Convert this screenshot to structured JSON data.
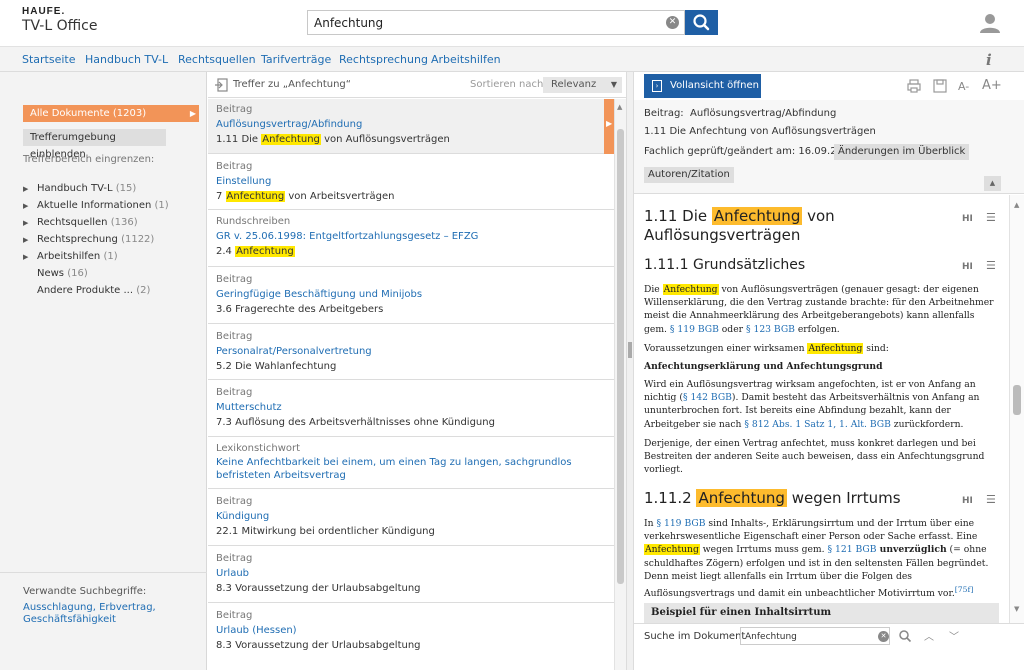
{
  "brand": {
    "logo": "HAUFE.",
    "product": "TV-L Office"
  },
  "search": {
    "value": "Anfechtung",
    "placeholder": ""
  },
  "nav": [
    "Startseite",
    "Handbuch TV-L",
    "Rechtsquellen",
    "Tarifverträge",
    "Rechtsprechung",
    "Arbeitshilfen"
  ],
  "left": {
    "all_docs": "Alle Dokumente (1203)",
    "show_env": "Trefferumgebung einblenden",
    "narrow_label": "Trefferbereich eingrenzen:",
    "facets": [
      {
        "label": "Handbuch TV-L",
        "count": "(15)",
        "expandable": true
      },
      {
        "label": "Aktuelle Informationen",
        "count": "(1)",
        "expandable": true
      },
      {
        "label": "Rechtsquellen",
        "count": "(136)",
        "expandable": true
      },
      {
        "label": "Rechtsprechung",
        "count": "(1122)",
        "expandable": true
      },
      {
        "label": "Arbeitshilfen",
        "count": "(1)",
        "expandable": true
      },
      {
        "label": "News",
        "count": "(16)",
        "expandable": false
      },
      {
        "label": "Andere Produkte ...",
        "count": "(2)",
        "expandable": false
      }
    ],
    "related_label": "Verwandte Suchbegriffe:",
    "related_links": "Ausschlagung, Erbvertrag, Geschäftsfähigkeit"
  },
  "hits_header": {
    "label": "Treffer zu „Anfechtung“",
    "sort_label": "Sortieren nach:",
    "sort_value": "Relevanz"
  },
  "hits": [
    {
      "category": "Beitrag",
      "title": "Auflösungsvertrag/Abfindung",
      "sub_pre": "1.11 Die ",
      "sub_hl": "Anfechtung",
      "sub_post": " von Auflösungsverträgen"
    },
    {
      "category": "Beitrag",
      "title": "Einstellung",
      "sub_pre": "7 ",
      "sub_hl": "Anfechtung",
      "sub_post": " von Arbeitsverträgen"
    },
    {
      "category": "Rundschreiben",
      "title": "GR v. 25.06.1998: Entgeltfortzahlungsgesetz – EFZG",
      "sub_pre": "2.4 ",
      "sub_hl": "Anfechtung",
      "sub_post": ""
    },
    {
      "category": "Beitrag",
      "title": "Geringfügige Beschäftigung und Minijobs",
      "sub_pre": "3.6 Fragerechte des Arbeitgebers",
      "sub_hl": "",
      "sub_post": ""
    },
    {
      "category": "Beitrag",
      "title": "Personalrat/Personalvertretung",
      "sub_pre": "5.2 Die Wahlanfechtung",
      "sub_hl": "",
      "sub_post": ""
    },
    {
      "category": "Beitrag",
      "title": "Mutterschutz",
      "sub_pre": "7.3 Auflösung des Arbeitsverhältnisses ohne Kündigung",
      "sub_hl": "",
      "sub_post": ""
    },
    {
      "category": "Lexikonstichwort",
      "title": "Keine Anfechtbarkeit bei einem, um einen Tag zu langen, sachgrundlos befristeten Arbeitsvertrag",
      "sub_pre": "",
      "sub_hl": "",
      "sub_post": ""
    },
    {
      "category": "Beitrag",
      "title": "Kündigung",
      "sub_pre": "22.1 Mitwirkung bei ordentlicher Kündigung",
      "sub_hl": "",
      "sub_post": ""
    },
    {
      "category": "Beitrag",
      "title": "Urlaub",
      "sub_pre": "8.3 Voraussetzung der Urlaubsabgeltung",
      "sub_hl": "",
      "sub_post": ""
    },
    {
      "category": "Beitrag",
      "title": "Urlaub (Hessen)",
      "sub_pre": "8.3 Voraussetzung der Urlaubsabgeltung",
      "sub_hl": "",
      "sub_post": ""
    }
  ],
  "right": {
    "fullview_label": "Vollansicht öffnen",
    "meta_label": "Beitrag:",
    "meta_title": "Auflösungsvertrag/Abfindung",
    "meta_section": "1.11 Die Anfechtung von Auflösungsverträgen",
    "meta_checked": "Fachlich geprüft/geändert am: 16.09.2015",
    "changes_btn": "Änderungen im Überblick",
    "authors_btn": "Autoren/Zitation",
    "h1_pre": "1.11 Die ",
    "h1_hl": "Anfechtung",
    "h1_post": " von Auflösungsverträgen",
    "h2a": "1.11.1 Grundsätzliches",
    "p1": {
      "a": "Die ",
      "hl": "Anfechtung",
      "b": " von Auflösungsverträgen (genauer gesagt: der eigenen Willenserklärung, die den Vertrag zustande brachte: für den Arbeitnehmer meist die Annahmeerklärung des Arbeitgeberangebots) kann allenfalls gem. ",
      "l1": "§ 119 BGB",
      "c": " oder ",
      "l2": "§ 123 BGB",
      "d": " erfolgen."
    },
    "p2": {
      "a": "Voraussetzungen einer wirksamen ",
      "hl": "Anfechtung",
      "b": " sind:"
    },
    "p3": "Anfechtungserklärung und Anfechtungsgrund",
    "p4": {
      "a": "Wird ein Auflösungsvertrag wirksam angefochten, ist er von Anfang an nichtig (",
      "l1": "§ 142 BGB",
      "b": "). Damit besteht das Arbeitsverhältnis von Anfang an ununterbrochen fort. Ist bereits eine Abfindung bezahlt, kann der Arbeitgeber sie nach ",
      "l2": "§ 812 Abs. 1 Satz 1, 1. Alt. BGB",
      "c": " zurückfordern."
    },
    "p5": "Derjenige, der einen Vertrag anfechtet, muss konkret darlegen und bei Bestreiten der anderen Seite auch beweisen, dass ein Anfechtungsgrund vorliegt.",
    "h2b_pre": "1.11.2 ",
    "h2b_hl": "Anfechtung",
    "h2b_post": " wegen Irrtums",
    "p6": {
      "a": "In ",
      "l1": "§ 119 BGB",
      "b": " sind Inhalts-, Erklärungsirrtum und der Irrtum über eine verkehrswesentliche Eigenschaft einer Person oder Sache erfasst. Eine ",
      "hl": "Anfechtung",
      "c": " wegen Irrtums muss gem. ",
      "l2": "§ 121 BGB",
      "bold": " unverzüglich",
      "d": " (= ohne schuldhaftes Zögern) erfolgen und ist in den seltensten Fällen begründet. Denn meist liegt allenfalls ein Irrtum über die Folgen des Auflösungsvertrags und damit ein unbeachtlicher Motivirrtum vor.",
      "fn": "[75f]"
    },
    "example": "Beispiel für einen Inhaltsirrtum",
    "hi_label": "HI",
    "docsearch_label": "Suche im Dokument",
    "docsearch_value": "Anfechtung"
  },
  "colors": {
    "accent_blue": "#1f5fa5",
    "link_blue": "#1f6db3",
    "orange": "#f29458",
    "highlight": "#ffe800",
    "highlight_strong": "#fdbb2d"
  }
}
